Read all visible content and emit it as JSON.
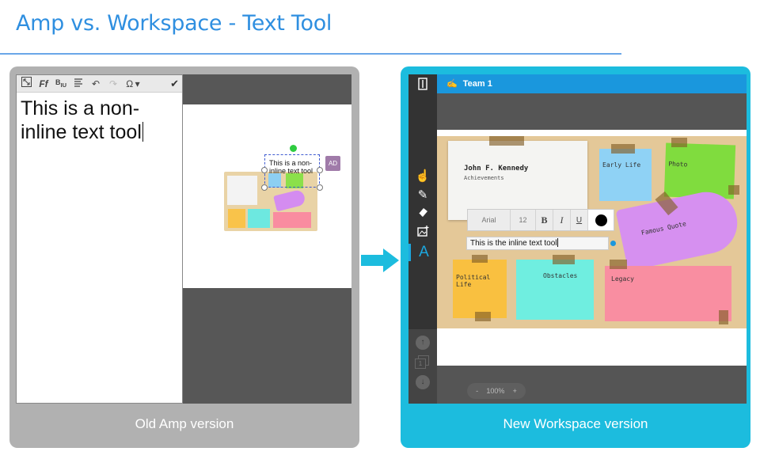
{
  "page": {
    "title": "Amp vs. Workspace - Text Tool"
  },
  "old_panel": {
    "caption": "Old Amp version",
    "toolbar": {
      "icons": [
        "fit-icon",
        "font-icon",
        "style-icon",
        "align-icon",
        "undo-icon",
        "redo-icon",
        "omega-icon",
        "check-icon"
      ]
    },
    "editor_text_line1": "This is a non-",
    "editor_text_line2": "inline text tool",
    "selection_text": "This is a non-inline text tool",
    "avatar_initials": "AD"
  },
  "new_panel": {
    "caption": "New Workspace version",
    "header_title": "Team 1",
    "paper_title": "John F. Kennedy",
    "paper_subtitle": "Achievements",
    "notes": {
      "early_life": "Early Life",
      "photo": "Photo",
      "famous_quote": "Famous Quote",
      "political_life": "Political Life",
      "obstacles": "Obstacles",
      "legacy": "Legacy"
    },
    "format_bar": {
      "font": "Arial",
      "size": "12",
      "bold": "B",
      "italic": "I",
      "underline": "U",
      "color": "#000000"
    },
    "inline_text": "This is the inline text tool",
    "zoom": {
      "minus": "-",
      "level": "100%",
      "plus": "+"
    },
    "layer_count": "1"
  },
  "colors": {
    "title": "#2f8fe0",
    "old_panel_bg": "#b1b1b1",
    "new_panel_bg": "#1cbcde",
    "header_blue": "#1a97dd",
    "arrow": "#1cbcde"
  }
}
